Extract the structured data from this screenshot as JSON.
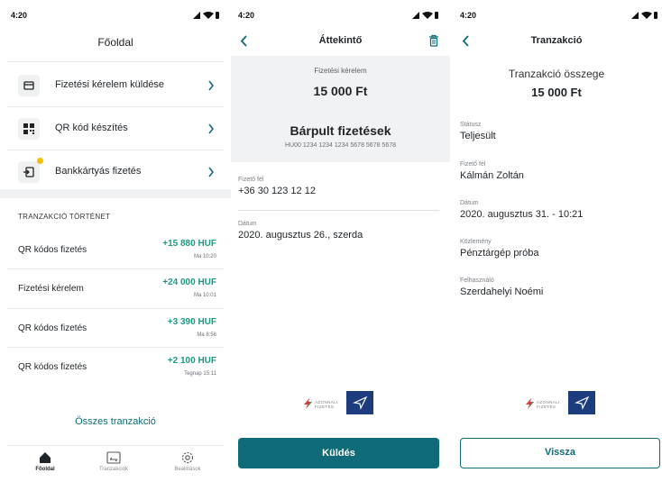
{
  "status": {
    "time": "4:20"
  },
  "home": {
    "title": "Főoldal",
    "menu": [
      {
        "label": "Fizetési kérelem küldése",
        "icon": "card-icon"
      },
      {
        "label": "QR kód készítés",
        "icon": "qr-icon"
      },
      {
        "label": "Bankkártyás fizetés",
        "icon": "card-insert-icon"
      }
    ],
    "history_title": "TRANZAKCIÓ TÖRTÉNET",
    "transactions": [
      {
        "name": "QR kódos fizetés",
        "amount": "+15 880 HUF",
        "time": "Ma 10:20"
      },
      {
        "name": "Fizetési kérelem",
        "amount": "+24 000 HUF",
        "time": "Ma 10:01"
      },
      {
        "name": "QR kódos fizetés",
        "amount": "+3 390 HUF",
        "time": "Ma 8:56"
      },
      {
        "name": "QR kódos fizetés",
        "amount": "+2 100 HUF",
        "time": "Tegnap 15:11"
      }
    ],
    "all_link": "Összes tranzakció",
    "tabs": [
      {
        "label": "Főoldal",
        "icon": "home-icon"
      },
      {
        "label": "Tranzakciók",
        "icon": "transactions-icon"
      },
      {
        "label": "Beállítások",
        "icon": "settings-icon"
      }
    ]
  },
  "overview": {
    "title": "Áttekintő",
    "request_label": "Fizetési kérelem",
    "request_amount": "15 000 Ft",
    "partner": "Bárpult fizetések",
    "iban": "HU00 1234 1234 1234 5678 5678 5678",
    "payer_label": "Fizető fél",
    "payer": "+36 30 123 12 12",
    "date_label": "Dátum",
    "date": "2020. augusztus 26., szerda",
    "send": "Küldés"
  },
  "logo": {
    "line1": "AZONNALI",
    "line2": "FIZETÉS"
  },
  "transaction": {
    "title": "Tranzakció",
    "amount_label": "Tranzakció összege",
    "amount": "15 000 Ft",
    "fields": [
      {
        "label": "Státusz",
        "value": "Teljesült"
      },
      {
        "label": "Fizető fél",
        "value": "Kálmán Zoltán"
      },
      {
        "label": "Dátum",
        "value": "2020. augusztus 31. - 10:21"
      },
      {
        "label": "Közlemény",
        "value": "Pénztárgép próba"
      },
      {
        "label": "Felhasználó",
        "value": "Szerdahelyi Noémi"
      }
    ],
    "back": "Vissza"
  },
  "colors": {
    "accent": "#0f6b78",
    "positive": "#1a9a82",
    "notice": "#f2c200"
  }
}
